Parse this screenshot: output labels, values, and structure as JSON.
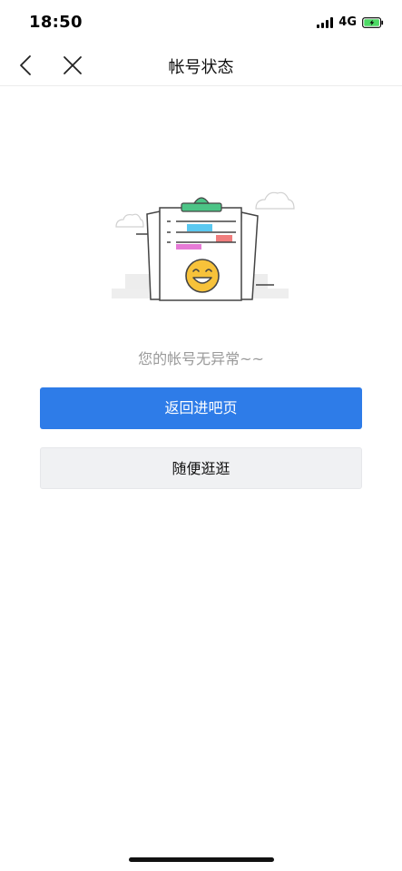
{
  "status_bar": {
    "time": "18:50",
    "network": "4G"
  },
  "nav": {
    "title": "帐号状态"
  },
  "main": {
    "message": "您的帐号无异常~~",
    "primary_button": "返回进吧页",
    "secondary_button": "随便逛逛"
  },
  "colors": {
    "primary": "#2e7ce8",
    "secondary_bg": "#f0f1f3",
    "message_text": "#9a9a9a",
    "battery_fill": "#4cd964"
  }
}
